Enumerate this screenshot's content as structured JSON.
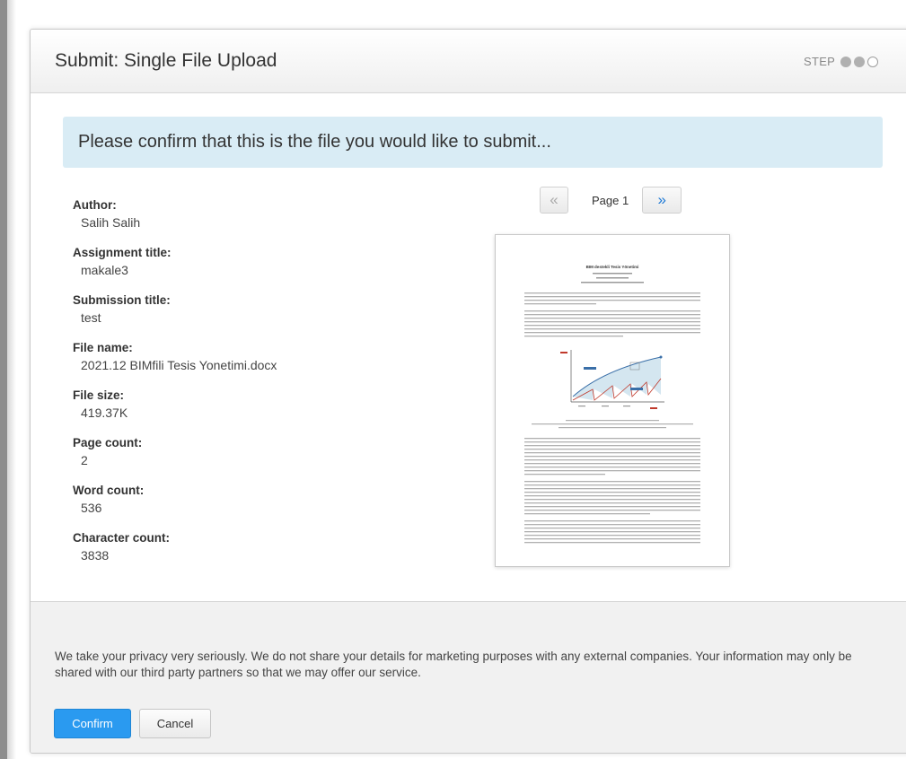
{
  "dialog": {
    "title": "Submit: Single File Upload",
    "step_label": "STEP",
    "steps": [
      "done",
      "done",
      "todo"
    ]
  },
  "banner": {
    "text": "Please confirm that this is the file you would like to submit..."
  },
  "details": [
    {
      "label": "Author:",
      "value": "Salih Salih"
    },
    {
      "label": "Assignment title:",
      "value": "makale3"
    },
    {
      "label": "Submission title:",
      "value": "test"
    },
    {
      "label": "File name:",
      "value": "2021.12 BIMfili Tesis Yonetimi.docx"
    },
    {
      "label": "File size:",
      "value": "419.37K"
    },
    {
      "label": "Page count:",
      "value": "2"
    },
    {
      "label": "Word count:",
      "value": "536"
    },
    {
      "label": "Character count:",
      "value": "3838"
    }
  ],
  "pager": {
    "prev": "«",
    "label": "Page 1",
    "next": "»"
  },
  "preview": {
    "heading": "BIM destekli Tesis Yönetimi"
  },
  "footer": {
    "privacy": "We take your privacy very seriously. We do not share your details for marketing purposes with any external companies. Your information may only be shared with our third party partners so that we may offer our service.",
    "confirm_label": "Confirm",
    "cancel_label": "Cancel"
  },
  "colors": {
    "accent": "#2a9af0",
    "banner_bg": "#d9ecf5",
    "pager_next": "#1f7ad6"
  }
}
